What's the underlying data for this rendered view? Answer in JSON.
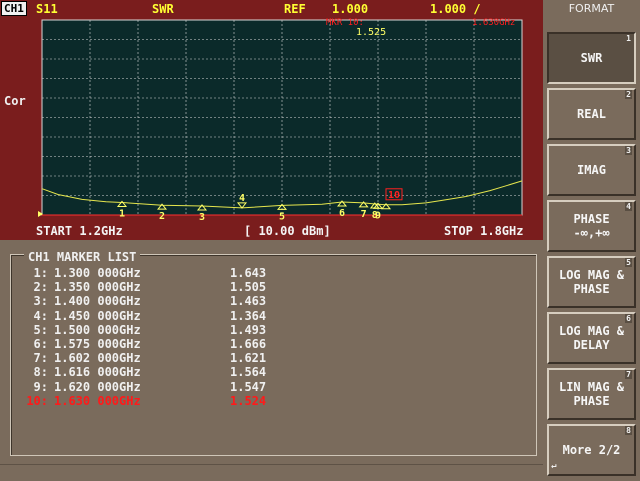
{
  "header": {
    "channel": "CH1",
    "parameter": "S11",
    "format": "SWR",
    "ref_label": "REF",
    "ref_value": "1.000",
    "scale": "1.000 /",
    "active_marker_readout": "MKR 10:",
    "active_marker_value": "1.525",
    "active_marker_freq": "1.630GHz"
  },
  "side_label": "Cor",
  "footer": {
    "start": "START 1.2GHz",
    "power": "[ 10.00 dBm]",
    "stop": "STOP 1.8GHz"
  },
  "colors": {
    "trace": "#e6e64d",
    "marker": "#ffff66",
    "active_marker": "#ff2020",
    "grid": "#d8d8d8",
    "plot_bg": "#0b2a2a"
  },
  "chart_data": {
    "type": "line",
    "xlabel": "",
    "ylabel": "",
    "x_range_ghz": [
      1.2,
      1.8
    ],
    "y_range": [
      1.0,
      11.0
    ],
    "grid": true,
    "series": [
      {
        "x": [
          1.2,
          1.22,
          1.25,
          1.28,
          1.3,
          1.35,
          1.4,
          1.45,
          1.5,
          1.55,
          1.575,
          1.602,
          1.616,
          1.62,
          1.63,
          1.65,
          1.68,
          1.7,
          1.73,
          1.76,
          1.78,
          1.8
        ],
        "values": [
          2.35,
          2.05,
          1.8,
          1.68,
          1.64,
          1.505,
          1.463,
          1.364,
          1.493,
          1.55,
          1.666,
          1.621,
          1.564,
          1.547,
          1.524,
          1.53,
          1.62,
          1.75,
          1.95,
          2.25,
          2.5,
          2.75
        ]
      }
    ],
    "markers": [
      {
        "label": "1",
        "x": 1.3,
        "y": 1.643
      },
      {
        "label": "2",
        "x": 1.35,
        "y": 1.505
      },
      {
        "label": "3",
        "x": 1.4,
        "y": 1.463
      },
      {
        "label": "4",
        "x": 1.45,
        "y": 1.364
      },
      {
        "label": "5",
        "x": 1.5,
        "y": 1.493
      },
      {
        "label": "6",
        "x": 1.575,
        "y": 1.666
      },
      {
        "label": "7",
        "x": 1.602,
        "y": 1.621
      },
      {
        "label": "8",
        "x": 1.616,
        "y": 1.564
      },
      {
        "label": "9",
        "x": 1.62,
        "y": 1.547
      },
      {
        "label": "10",
        "x": 1.63,
        "y": 1.524
      }
    ]
  },
  "marker_list": {
    "title": "CH1 MARKER LIST",
    "rows": [
      {
        "idx": "1:",
        "freq": "1.300 000GHz",
        "value": "1.643",
        "active": false
      },
      {
        "idx": "2:",
        "freq": "1.350 000GHz",
        "value": "1.505",
        "active": false
      },
      {
        "idx": "3:",
        "freq": "1.400 000GHz",
        "value": "1.463",
        "active": false
      },
      {
        "idx": "4:",
        "freq": "1.450 000GHz",
        "value": "1.364",
        "active": false
      },
      {
        "idx": "5:",
        "freq": "1.500 000GHz",
        "value": "1.493",
        "active": false
      },
      {
        "idx": "6:",
        "freq": "1.575 000GHz",
        "value": "1.666",
        "active": false
      },
      {
        "idx": "7:",
        "freq": "1.602 000GHz",
        "value": "1.621",
        "active": false
      },
      {
        "idx": "8:",
        "freq": "1.616 000GHz",
        "value": "1.564",
        "active": false
      },
      {
        "idx": "9:",
        "freq": "1.620 000GHz",
        "value": "1.547",
        "active": false
      },
      {
        "idx": "10:",
        "freq": "1.630 000GHz",
        "value": "1.524",
        "active": true
      }
    ]
  },
  "softkeys": {
    "title": "FORMAT",
    "keys": [
      {
        "line1": "SWR",
        "line2": "",
        "num": "1"
      },
      {
        "line1": "REAL",
        "line2": "",
        "num": "2"
      },
      {
        "line1": "IMAG",
        "line2": "",
        "num": "3"
      },
      {
        "line1": "PHASE",
        "line2": "-∞,+∞",
        "num": "4"
      },
      {
        "line1": "LOG MAG &",
        "line2": "PHASE",
        "num": "5"
      },
      {
        "line1": "LOG MAG &",
        "line2": "DELAY",
        "num": "6"
      },
      {
        "line1": "LIN MAG &",
        "line2": "PHASE",
        "num": "7"
      },
      {
        "line1": "More 2/2",
        "line2": "",
        "num": "8"
      }
    ],
    "more_corner_icon": "return-arrow-icon"
  }
}
